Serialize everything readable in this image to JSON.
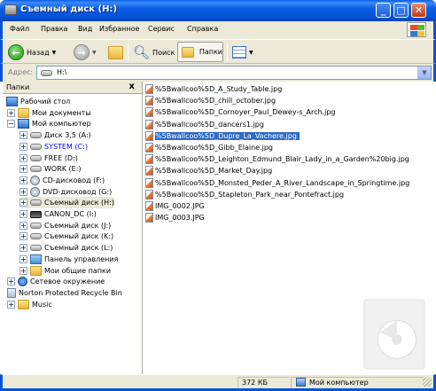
{
  "window": {
    "title": "Съемный диск (H:)"
  },
  "menu": [
    "Файл",
    "Правка",
    "Вид",
    "Избранное",
    "Сервис",
    "Справка"
  ],
  "toolbar": {
    "back": "Назад",
    "search": "Поиск",
    "folders": "Папки"
  },
  "address": {
    "label": "Адрес:",
    "value": "H:\\"
  },
  "folders_pane": {
    "title": "Папки",
    "close": "x",
    "tree": [
      {
        "label": "Рабочий стол",
        "icon": "desktop-icon",
        "level": 0,
        "expander": ""
      },
      {
        "label": "Мои документы",
        "icon": "folder-icon",
        "level": 1,
        "expander": "+"
      },
      {
        "label": "Мой компьютер",
        "icon": "computer-icon",
        "level": 1,
        "expander": "−"
      },
      {
        "label": "Диск 3,5 (A:)",
        "icon": "floppy-icon",
        "level": 2,
        "expander": "+"
      },
      {
        "label": "SYSTEM (C:)",
        "icon": "drive-icon",
        "level": 2,
        "expander": "+",
        "color": "#0000ff"
      },
      {
        "label": "FREE (D:)",
        "icon": "drive-icon",
        "level": 2,
        "expander": "+"
      },
      {
        "label": "WORK (E:)",
        "icon": "drive-icon",
        "level": 2,
        "expander": "+"
      },
      {
        "label": "CD-дисковод (F:)",
        "icon": "cd-icon",
        "level": 2,
        "expander": "+"
      },
      {
        "label": "DVD-дисковод (G:)",
        "icon": "dvd-icon",
        "level": 2,
        "expander": "+"
      },
      {
        "label": "Съемный диск (H:)",
        "icon": "removable-drive-icon",
        "level": 2,
        "expander": "+",
        "selected": true
      },
      {
        "label": "CANON_DC (I:)",
        "icon": "camera-icon",
        "level": 2,
        "expander": "+"
      },
      {
        "label": "Съемный диск (J:)",
        "icon": "removable-drive-icon",
        "level": 2,
        "expander": "+"
      },
      {
        "label": "Съемный диск (K:)",
        "icon": "removable-drive-icon",
        "level": 2,
        "expander": "+"
      },
      {
        "label": "Съемный диск (L:)",
        "icon": "removable-drive-icon",
        "level": 2,
        "expander": "+"
      },
      {
        "label": "Панель управления",
        "icon": "control-panel-icon",
        "level": 2,
        "expander": "+"
      },
      {
        "label": "Мои общие папки",
        "icon": "shared-folder-icon",
        "level": 2,
        "expander": "+"
      },
      {
        "label": "Сетевое окружение",
        "icon": "network-icon",
        "level": 1,
        "expander": "+"
      },
      {
        "label": "Norton Protected Recycle Bin",
        "icon": "recycle-bin-icon",
        "level": 1,
        "expander": ""
      },
      {
        "label": "Music",
        "icon": "folder-icon",
        "level": 1,
        "expander": "+"
      }
    ]
  },
  "files": [
    {
      "name": "%5Bwallcoo%5D_A_Study_Table.jpg"
    },
    {
      "name": "%5Bwallcoo%5D_chill_october.jpg"
    },
    {
      "name": "%5Bwallcoo%5D_Cornoyer_Paul_Dewey-s_Arch.jpg"
    },
    {
      "name": "%5Bwallcoo%5D_dancers1.jpg"
    },
    {
      "name": "%5Bwallcoo%5D_Dupre_La_Vachere.jpg",
      "selected": true
    },
    {
      "name": "%5Bwallcoo%5D_Gibb_Elaine.jpg"
    },
    {
      "name": "%5Bwallcoo%5D_Leighton_Edmund_Blair_Lady_in_a_Garden%20big.jpg"
    },
    {
      "name": "%5Bwallcoo%5D_Market_Day.jpg"
    },
    {
      "name": "%5Bwallcoo%5D_Monsted_Peder_A_River_Landscape_in_Springtime.jpg"
    },
    {
      "name": "%5Bwallcoo%5D_Stapleton_Park_near_Pontefract.jpg"
    },
    {
      "name": "IMG_0002.JPG"
    },
    {
      "name": "IMG_0003.JPG"
    }
  ],
  "status": {
    "size": "372 КБ",
    "location": "Мой компьютер"
  },
  "colors": {
    "titlebar": "#0553d8",
    "selection": "#316ac5",
    "chrome": "#ece9d8"
  }
}
